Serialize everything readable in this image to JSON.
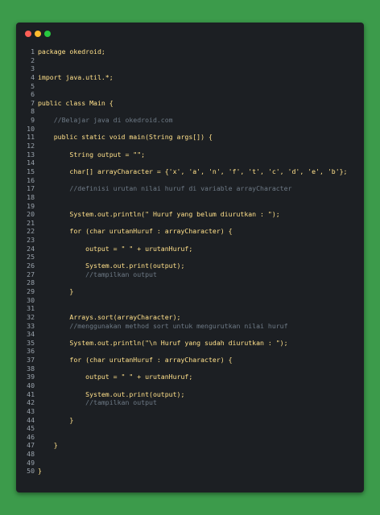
{
  "window": {
    "title_dots": [
      {
        "name": "close-dot",
        "color": "#ff5f57"
      },
      {
        "name": "minimize-dot",
        "color": "#febc2e"
      },
      {
        "name": "maximize-dot",
        "color": "#28c840"
      }
    ]
  },
  "colors": {
    "background": "#3c9b4b",
    "editor": "#1c1f23",
    "code": "#ffe08a",
    "comment": "#6e7a86",
    "line_number": "#9aa3ad"
  },
  "code": {
    "lines": [
      {
        "n": "1",
        "text": "package okedroid;"
      },
      {
        "n": "2",
        "text": ""
      },
      {
        "n": "3",
        "text": ""
      },
      {
        "n": "4",
        "text": "import java.util.*;"
      },
      {
        "n": "5",
        "text": ""
      },
      {
        "n": "6",
        "text": ""
      },
      {
        "n": "7",
        "text": "public class Main {"
      },
      {
        "n": "8",
        "text": ""
      },
      {
        "n": "9",
        "text": "    //Belajar java di okedroid.com",
        "comment": true
      },
      {
        "n": "10",
        "text": ""
      },
      {
        "n": "11",
        "text": "    public static void main(String args[]) {"
      },
      {
        "n": "12",
        "text": ""
      },
      {
        "n": "13",
        "text": "        String output = \"\";"
      },
      {
        "n": "14",
        "text": ""
      },
      {
        "n": "15",
        "text": "        char[] arrayCharacter = {'x', 'a', 'n', 'f', 't', 'c', 'd', 'e', 'b'};"
      },
      {
        "n": "16",
        "text": ""
      },
      {
        "n": "17",
        "text": "        //definisi urutan nilai huruf di variable arrayCharacter",
        "comment": true
      },
      {
        "n": "18",
        "text": ""
      },
      {
        "n": "19",
        "text": ""
      },
      {
        "n": "20",
        "text": "        System.out.println(\" Huruf yang belum diurutkan : \");"
      },
      {
        "n": "21",
        "text": ""
      },
      {
        "n": "22",
        "text": "        for (char urutanHuruf : arrayCharacter) {"
      },
      {
        "n": "23",
        "text": ""
      },
      {
        "n": "24",
        "text": "            output = \" \" + urutanHuruf;"
      },
      {
        "n": "25",
        "text": ""
      },
      {
        "n": "26",
        "text": "            System.out.print(output);"
      },
      {
        "n": "27",
        "text": "            //tampilkan output",
        "comment": true
      },
      {
        "n": "28",
        "text": ""
      },
      {
        "n": "29",
        "text": "        }"
      },
      {
        "n": "30",
        "text": ""
      },
      {
        "n": "31",
        "text": ""
      },
      {
        "n": "32",
        "text": "        Arrays.sort(arrayCharacter);"
      },
      {
        "n": "33",
        "text": "        //menggunakan method sort untuk mengurutkan nilai huruf",
        "comment": true
      },
      {
        "n": "34",
        "text": ""
      },
      {
        "n": "35",
        "text": "        System.out.println(\"\\n Huruf yang sudah diurutkan : \");"
      },
      {
        "n": "36",
        "text": ""
      },
      {
        "n": "37",
        "text": "        for (char urutanHuruf : arrayCharacter) {"
      },
      {
        "n": "38",
        "text": ""
      },
      {
        "n": "39",
        "text": "            output = \" \" + urutanHuruf;"
      },
      {
        "n": "40",
        "text": ""
      },
      {
        "n": "41",
        "text": "            System.out.print(output);"
      },
      {
        "n": "42",
        "text": "            //tampilkan output",
        "comment": true
      },
      {
        "n": "43",
        "text": ""
      },
      {
        "n": "44",
        "text": "        }"
      },
      {
        "n": "45",
        "text": ""
      },
      {
        "n": "46",
        "text": ""
      },
      {
        "n": "47",
        "text": "    }"
      },
      {
        "n": "48",
        "text": ""
      },
      {
        "n": "49",
        "text": ""
      },
      {
        "n": "50",
        "text": "}"
      }
    ]
  }
}
